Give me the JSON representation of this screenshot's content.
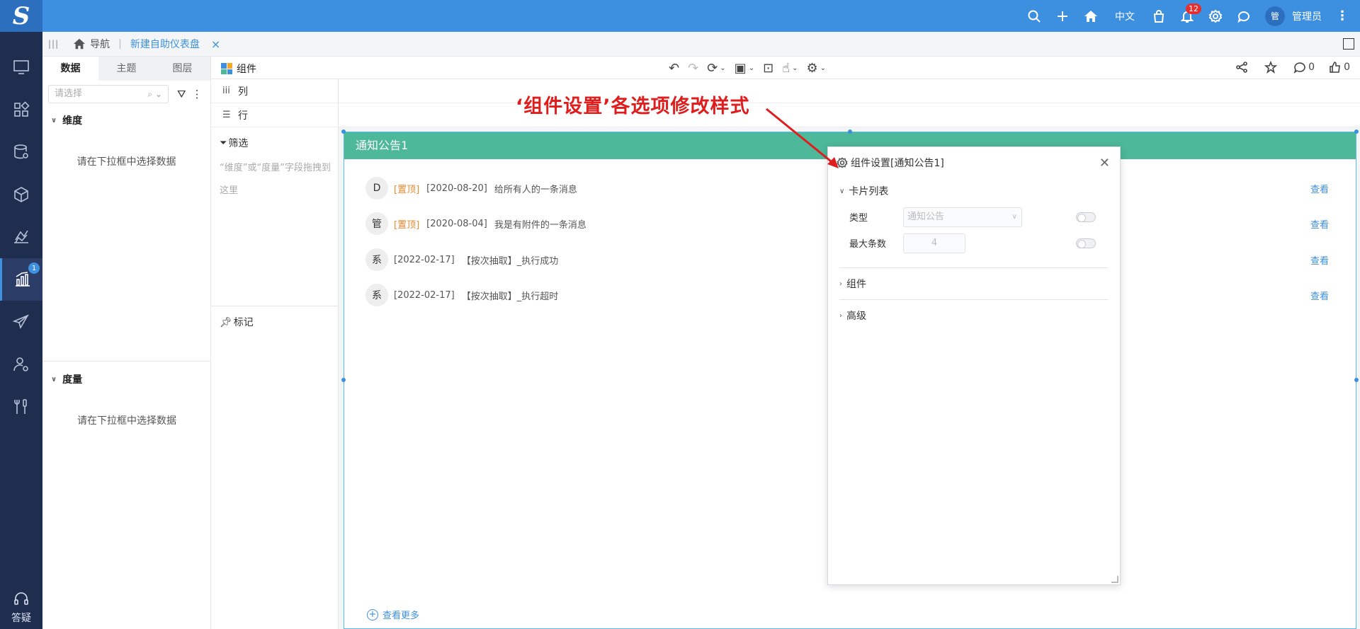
{
  "topbar": {
    "logo": "S",
    "language": "中文",
    "notification_count": "12",
    "user_initial": "管",
    "user_name": "管理员"
  },
  "leftnav": {
    "items": [
      {
        "icon": "monitor-icon"
      },
      {
        "icon": "apps-icon"
      },
      {
        "icon": "database-icon"
      },
      {
        "icon": "cube-icon"
      },
      {
        "icon": "analysis-icon"
      },
      {
        "icon": "dashboard-chart-icon",
        "active": true,
        "badge": "1"
      },
      {
        "icon": "paper-plane-icon"
      },
      {
        "icon": "user-settings-icon"
      },
      {
        "icon": "tools-icon"
      }
    ],
    "help_label": "答疑"
  },
  "tabbar": {
    "home_label": "导航",
    "current_tab": "新建自助仪表盘",
    "close": "×"
  },
  "data_panel": {
    "tabs": [
      "数据",
      "主题",
      "图层"
    ],
    "select_placeholder": "请选择",
    "dimension_title": "维度",
    "dimension_tip": "请在下拉框中选择数据",
    "measure_title": "度量",
    "measure_tip": "请在下拉框中选择数据"
  },
  "field_panel": {
    "components_label": "组件",
    "columns_label": "列",
    "rows_label": "行",
    "filter_label": "筛选",
    "filter_tip": "“维度”或“度量”字段拖拽到这里",
    "mark_label": "标记"
  },
  "toolbar": {
    "comment_count": "0",
    "like_count": "0"
  },
  "widget": {
    "title": "通知公告1",
    "notices": [
      {
        "avatar": "D",
        "pinned": "[置顶]",
        "date": "[2020-08-20]",
        "text": "给所有人的一条消息",
        "view": "查看"
      },
      {
        "avatar": "管",
        "pinned": "[置顶]",
        "date": "[2020-08-04]",
        "text": "我是有附件的一条消息",
        "view": "查看"
      },
      {
        "avatar": "系",
        "pinned": "",
        "date": "[2022-02-17]",
        "text": "【按次抽取】_执行成功",
        "view": "查看"
      },
      {
        "avatar": "系",
        "pinned": "",
        "date": "[2022-02-17]",
        "text": "【按次抽取】_执行超时",
        "view": "查看"
      }
    ],
    "more_label": "查看更多"
  },
  "dialog": {
    "title": "组件设置[通知公告1]",
    "group_card": "卡片列表",
    "type_label": "类型",
    "type_value": "通知公告",
    "max_label": "最大条数",
    "max_value": "4",
    "group_component": "组件",
    "group_advanced": "高级"
  },
  "annotation": {
    "text": "‘组件设置’各选项修改样式",
    "color": "#e01d1d"
  }
}
